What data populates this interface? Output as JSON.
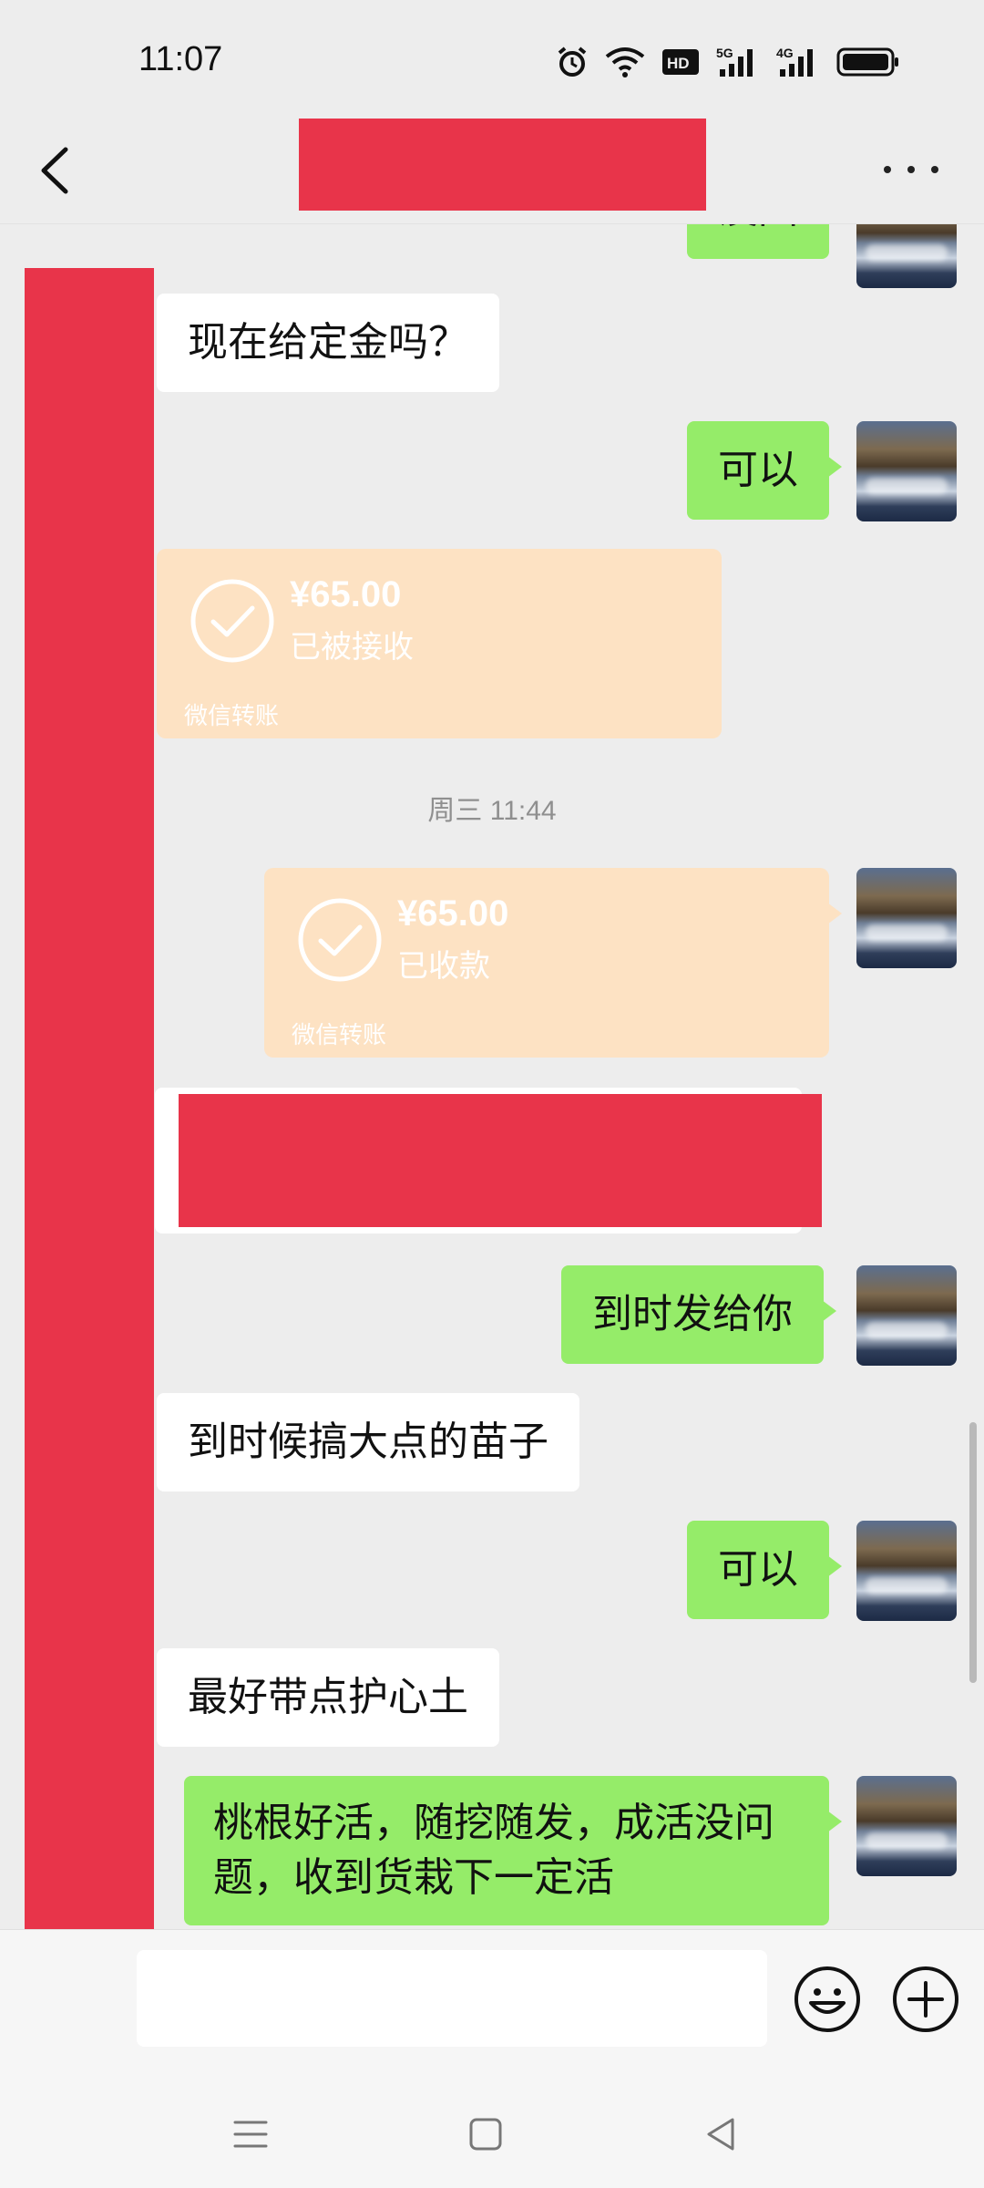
{
  "status_bar": {
    "time": "11:07",
    "icons": [
      "alarm-icon",
      "wifi-icon",
      "hd-icon",
      "signal-5g-icon",
      "signal-4g-icon",
      "battery-icon"
    ],
    "hd_label": "HD",
    "net1_label": "5G",
    "net2_label": "4G"
  },
  "header": {
    "title": "",
    "back_icon": "chevron-left-icon",
    "more_icon": "more-horizontal-icon"
  },
  "colors": {
    "background": "#ededed",
    "outgoing_bubble": "#95ec69",
    "incoming_bubble": "#ffffff",
    "transfer_card": "#fde2c3",
    "redaction": "#e8344a"
  },
  "messages": [
    {
      "id": "m0",
      "direction": "out",
      "text": "没回",
      "partial": true
    },
    {
      "id": "m1",
      "direction": "in",
      "text": "现在给定金吗？"
    },
    {
      "id": "m2",
      "direction": "out",
      "text": "可以"
    },
    {
      "id": "m3",
      "direction": "in",
      "type": "transfer",
      "amount": "¥65.00",
      "status": "已被接收",
      "brand": "微信转账"
    },
    {
      "id": "t1",
      "type": "timestamp",
      "text": "周三 11:44"
    },
    {
      "id": "m4",
      "direction": "out",
      "type": "transfer",
      "amount": "¥65.00",
      "status": "已收款",
      "brand": "微信转账"
    },
    {
      "id": "m5",
      "direction": "in",
      "text": "",
      "redacted": true
    },
    {
      "id": "m6",
      "direction": "out",
      "text": "到时发给你"
    },
    {
      "id": "m7",
      "direction": "in",
      "text": "到时候搞大点的苗子"
    },
    {
      "id": "m8",
      "direction": "out",
      "text": "可以"
    },
    {
      "id": "m9",
      "direction": "in",
      "text": "最好带点护心土"
    },
    {
      "id": "m10",
      "direction": "out",
      "text": "桃根好活，随挖随发，成活没问题，收到货栽下一定活"
    }
  ],
  "input_bar": {
    "placeholder": "",
    "emoji_icon": "smiley-icon",
    "plus_icon": "plus-circle-icon"
  },
  "nav_bar": {
    "icons": [
      "menu-icon",
      "home-square-icon",
      "back-triangle-icon"
    ]
  }
}
